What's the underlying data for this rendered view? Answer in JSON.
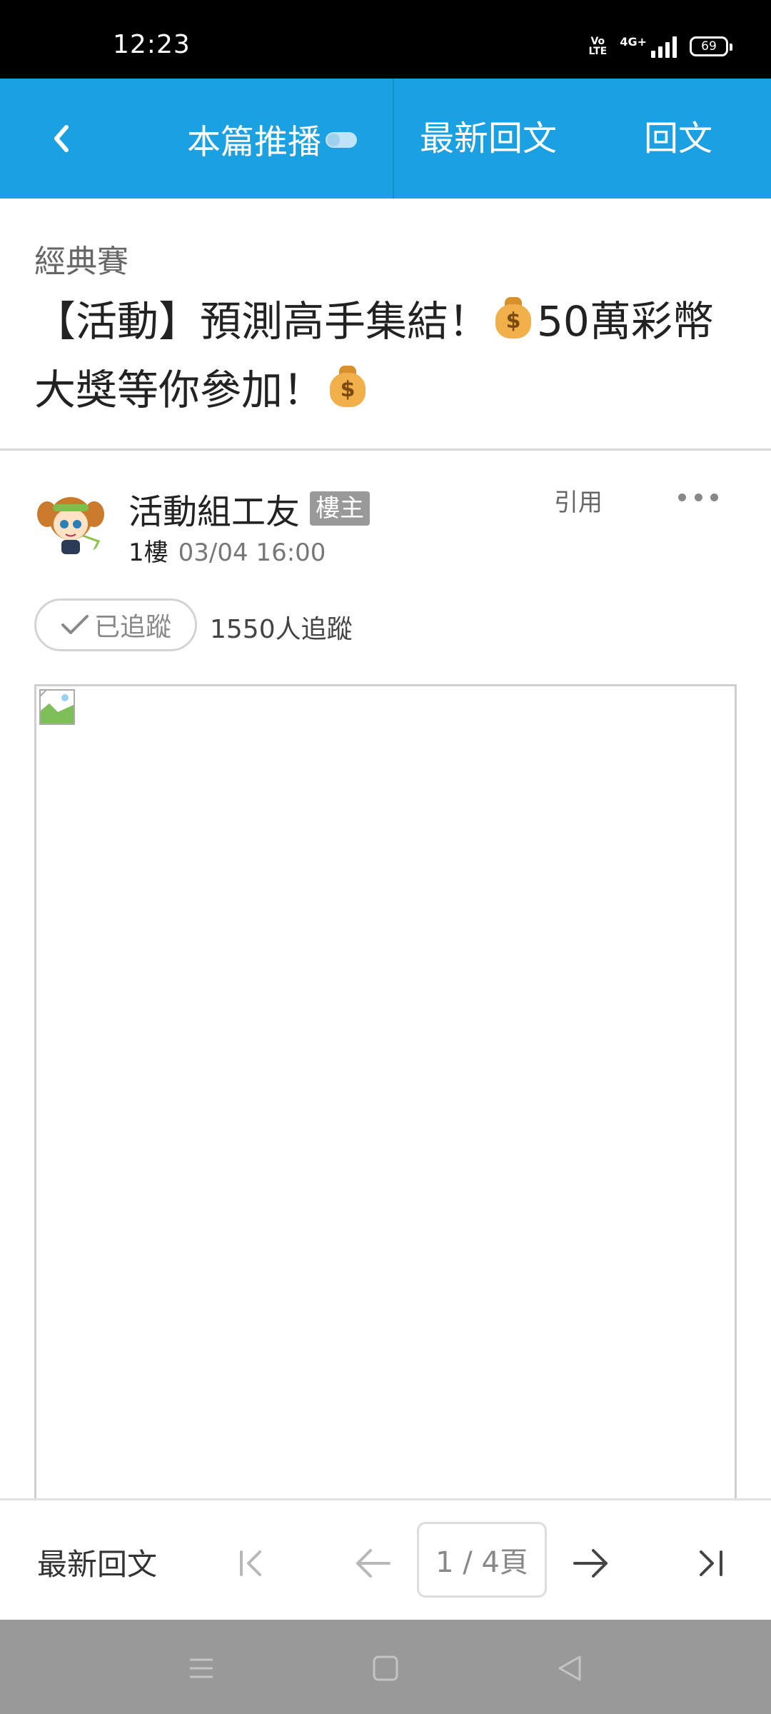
{
  "status_bar": {
    "time": "12:23",
    "volte": "Vo\nLTE",
    "network": "4G+",
    "battery": "69"
  },
  "app_bar": {
    "back_icon": "chevron-left-icon",
    "push_label": "本篇推播",
    "latest_label": "最新回文",
    "reply_label": "回文"
  },
  "post": {
    "board": "經典賽",
    "title_part1": "【活動】預測高手集結！",
    "title_part2": "50萬彩幣大獎等你參加！",
    "moneybag_symbol": "$",
    "author": "活動組工友",
    "author_badge": "樓主",
    "floor": "1樓",
    "date": "03/04 16:00",
    "quote_label": "引用",
    "follow_label": "已追蹤",
    "follow_count": "1550人追蹤"
  },
  "bottom_bar": {
    "latest_label": "最新回文",
    "page_indicator": "1 / 4頁"
  },
  "colors": {
    "brand_blue": "#1ba1e2",
    "system_nav": "#999999"
  }
}
